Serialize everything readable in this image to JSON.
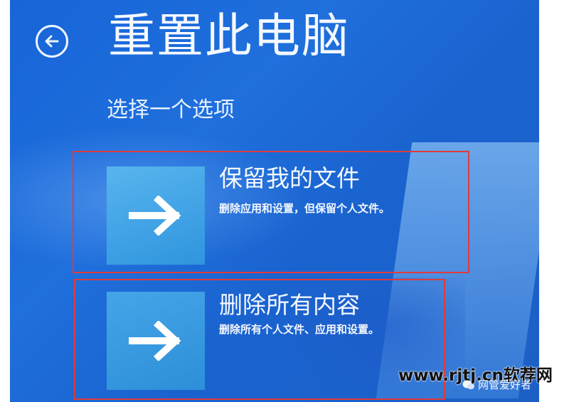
{
  "header": {
    "back_icon": "arrow-left-circle-icon",
    "title": "重置此电脑",
    "subtitle": "选择一个选项"
  },
  "options": [
    {
      "icon": "arrow-right-icon",
      "title": "保留我的文件",
      "description": "删除应用和设置，但保留个人文件。"
    },
    {
      "icon": "arrow-right-icon",
      "title": "删除所有内容",
      "description": "删除所有个人文件、应用和设置。"
    }
  ],
  "watermark": {
    "site": "www.rjtj.cn软荐网",
    "account": "网管爱好者",
    "account_icon": "wechat-icon"
  },
  "colors": {
    "background": "#1c66d4",
    "tile": "#3fa0e3",
    "highlight_border": "#e03b3b",
    "text": "#f4f8ff"
  }
}
